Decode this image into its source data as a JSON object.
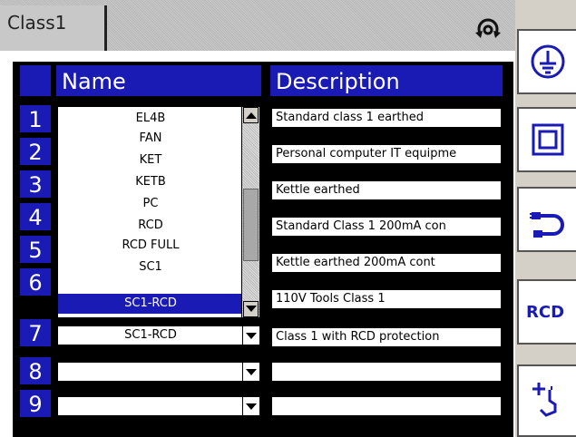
{
  "tab": {
    "label": "Class1"
  },
  "table": {
    "header_name": "Name",
    "header_description": "Description",
    "rows": [
      {
        "num": "1",
        "name": "",
        "description": "Standard class 1 earthed"
      },
      {
        "num": "2",
        "name": "",
        "description": "Personal computer IT equipme"
      },
      {
        "num": "3",
        "name": "",
        "description": "Kettle earthed"
      },
      {
        "num": "4",
        "name": "",
        "description": "Standard Class 1 200mA con"
      },
      {
        "num": "5",
        "name": "",
        "description": "Kettle earthed 200mA cont"
      },
      {
        "num": "6",
        "name": "",
        "description": "110V Tools Class 1"
      },
      {
        "num": "7",
        "name": "SC1-RCD",
        "description": "Class 1 with RCD protection"
      },
      {
        "num": "8",
        "name": "",
        "description": ""
      },
      {
        "num": "9",
        "name": "",
        "description": ""
      }
    ]
  },
  "dropdown": {
    "items": [
      "EL4B",
      "FAN",
      "KET",
      "KETB",
      "PC",
      "RCD",
      "RCD FULL",
      "SC1",
      "SC1-RCD"
    ],
    "selected": "SC1-RCD"
  },
  "sidebar": {
    "rcd_label": "RCD"
  },
  "colors": {
    "accent": "#1a1ab4",
    "header_bg": "#c8c8c8"
  }
}
